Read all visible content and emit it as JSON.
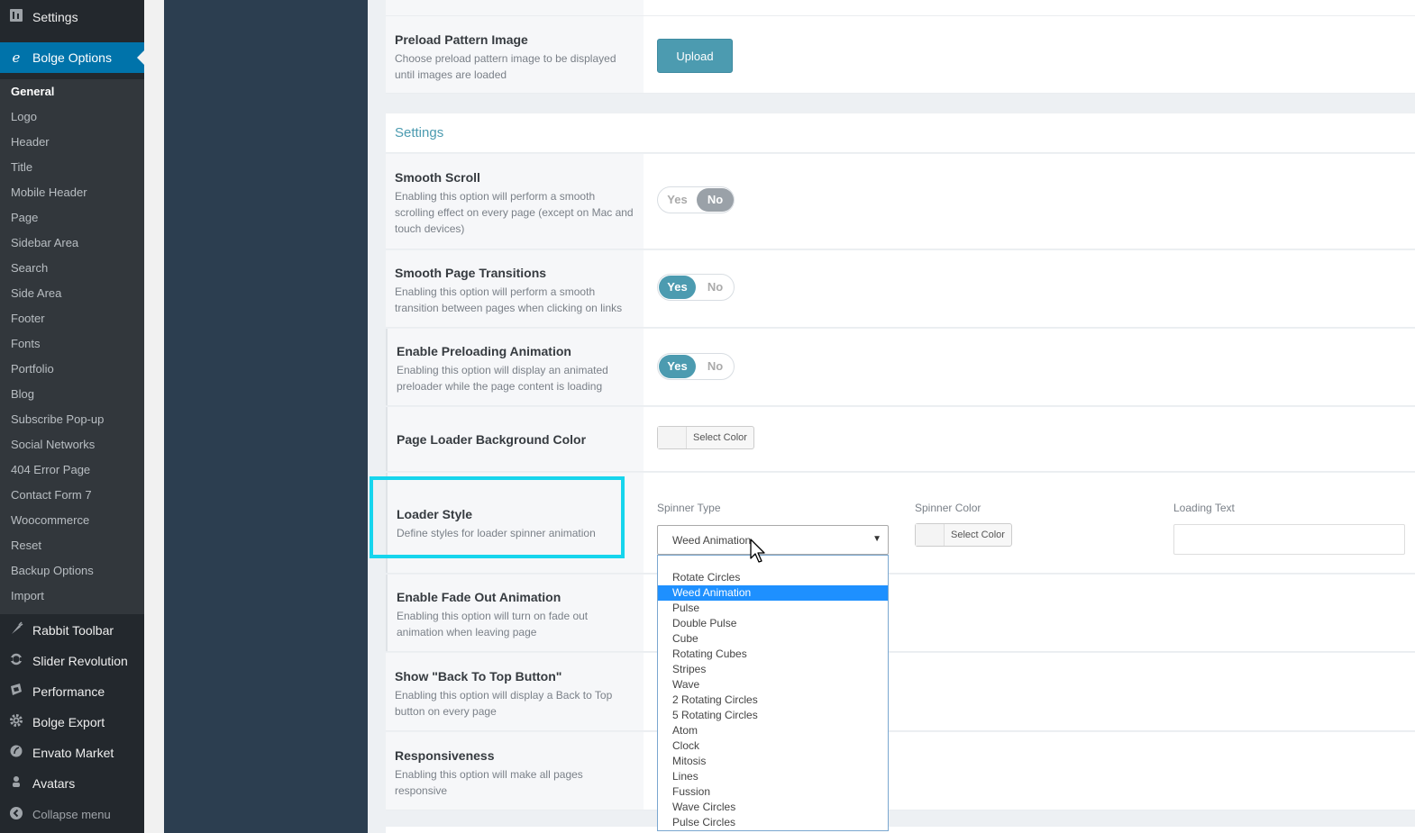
{
  "sidebar": {
    "settings_label": "Settings",
    "bolge_label": "Bolge Options",
    "submenu": [
      "General",
      "Logo",
      "Header",
      "Title",
      "Mobile Header",
      "Page",
      "Sidebar Area",
      "Search",
      "Side Area",
      "Footer",
      "Fonts",
      "Portfolio",
      "Blog",
      "Subscribe Pop-up",
      "Social Networks",
      "404 Error Page",
      "Contact Form 7",
      "Woocommerce",
      "Reset",
      "Backup Options",
      "Import"
    ],
    "lower": [
      {
        "label": "Rabbit Toolbar",
        "icon": "carrot-icon"
      },
      {
        "label": "Slider Revolution",
        "icon": "refresh-icon"
      },
      {
        "label": "Performance",
        "icon": "performance-icon"
      },
      {
        "label": "Bolge Export",
        "icon": "gear-icon"
      },
      {
        "label": "Envato Market",
        "icon": "leaf-icon"
      },
      {
        "label": "Avatars",
        "icon": "avatar-icon"
      }
    ],
    "collapse_label": "Collapse menu"
  },
  "preload_pattern": {
    "title": "Preload Pattern Image",
    "desc": "Choose preload pattern image to be displayed until images are loaded",
    "button": "Upload"
  },
  "settings_section": {
    "title": "Settings",
    "smooth_scroll": {
      "title": "Smooth Scroll",
      "desc": "Enabling this option will perform a smooth scrolling effect on every page (except on Mac and touch devices)",
      "yes": "Yes",
      "no": "No",
      "value": "No"
    },
    "smooth_transitions": {
      "title": "Smooth Page Transitions",
      "desc": "Enabling this option will perform a smooth transition between pages when clicking on links",
      "yes": "Yes",
      "no": "No",
      "value": "Yes"
    },
    "preloading": {
      "title": "Enable Preloading Animation",
      "desc": "Enabling this option will display an animated preloader while the page content is loading",
      "yes": "Yes",
      "no": "No",
      "value": "Yes"
    },
    "loader_bg": {
      "title": "Page Loader Background Color",
      "button": "Select Color"
    },
    "loader_style": {
      "title": "Loader Style",
      "desc": "Define styles for loader spinner animation",
      "spinner_type_label": "Spinner Type",
      "spinner_type_value": "Weed Animation",
      "spinner_color_label": "Spinner Color",
      "spinner_color_button": "Select Color",
      "loading_text_label": "Loading Text",
      "loading_text_value": ""
    },
    "fade_out": {
      "title": "Enable Fade Out Animation",
      "desc": "Enabling this option will turn on fade out animation when leaving page"
    },
    "back_to_top": {
      "title": "Show \"Back To Top Button\"",
      "desc": "Enabling this option will display a Back to Top button on every page"
    },
    "responsiveness": {
      "title": "Responsiveness",
      "desc": "Enabling this option will make all pages responsive"
    }
  },
  "dropdown": {
    "options": [
      "Rotate Circles",
      "Weed Animation",
      "Pulse",
      "Double Pulse",
      "Cube",
      "Rotating Cubes",
      "Stripes",
      "Wave",
      "2 Rotating Circles",
      "5 Rotating Circles",
      "Atom",
      "Clock",
      "Mitosis",
      "Lines",
      "Fussion",
      "Wave Circles",
      "Pulse Circles"
    ],
    "selected": "Weed Animation"
  },
  "colors": {
    "accent": "#4c9bb0",
    "sidebar_bg": "#23282d",
    "active_menu": "#0073aa",
    "highlight": "#16d5ed",
    "dropdown_selected": "#1e90ff"
  }
}
